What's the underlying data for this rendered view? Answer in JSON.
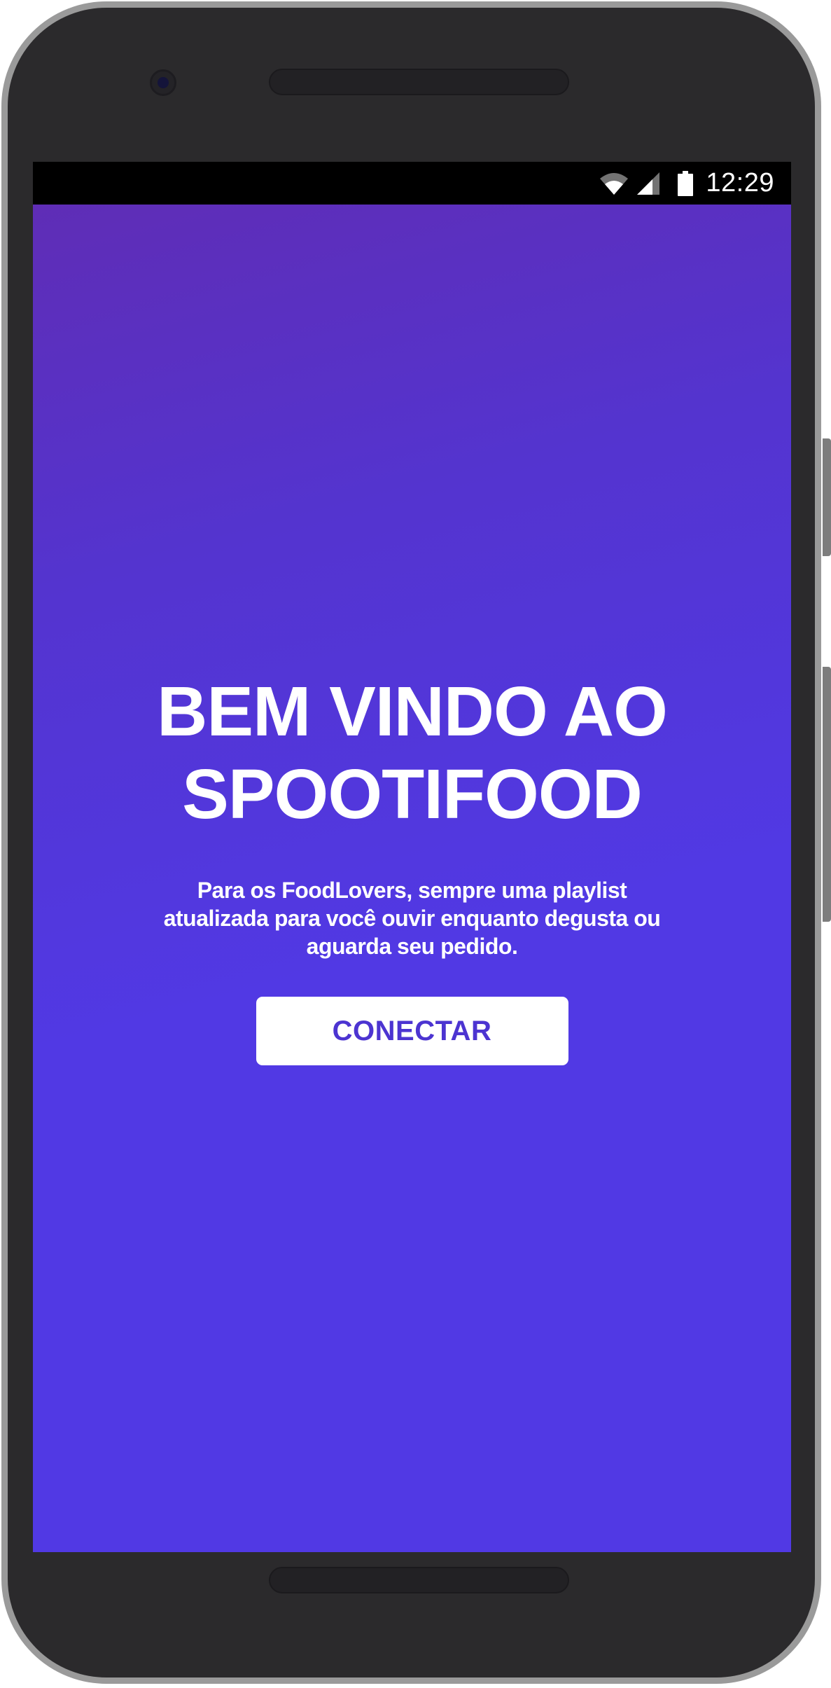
{
  "status_bar": {
    "time": "12:29",
    "icons": [
      "wifi-icon",
      "cell-signal-icon",
      "battery-icon"
    ]
  },
  "welcome": {
    "title": "BEM VINDO AO SPOOTIFOOD",
    "subtitle": "Para os FoodLovers, sempre uma playlist atualizada para você ouvir enquanto degusta ou aguarda seu pedido.",
    "connect_label": "CONECTAR"
  },
  "colors": {
    "background_top": "#5f2db6",
    "background_main": "#5139e4",
    "button_background": "#ffffff",
    "button_text": "#4c34d1",
    "text": "#ffffff"
  }
}
